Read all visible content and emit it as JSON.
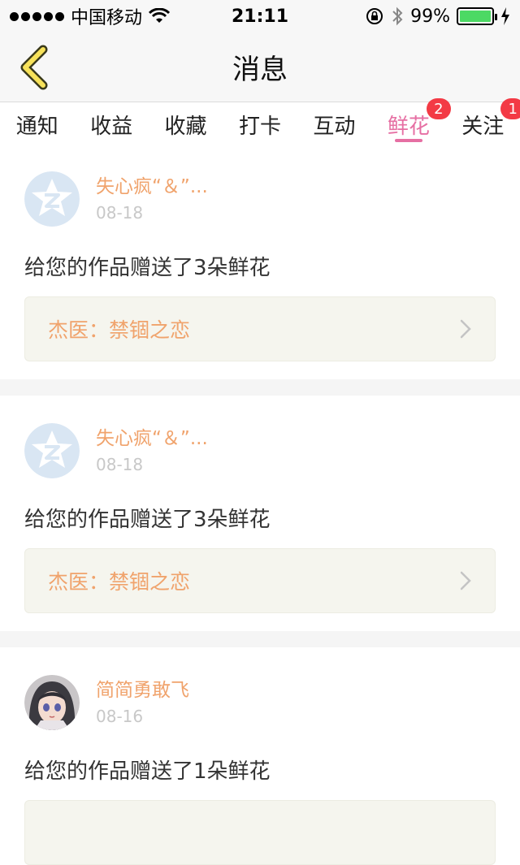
{
  "status_bar": {
    "carrier": "中国移动",
    "time": "21:11",
    "battery": "99%",
    "battery_level": 0.99
  },
  "nav": {
    "title": "消息"
  },
  "tabs": [
    {
      "label": "通知"
    },
    {
      "label": "收益"
    },
    {
      "label": "收藏"
    },
    {
      "label": "打卡"
    },
    {
      "label": "互动"
    },
    {
      "label": "鲜花",
      "badge": "2",
      "active": true
    },
    {
      "label": "关注",
      "badge": "1"
    }
  ],
  "messages": [
    {
      "username": "失心疯“＆”...",
      "date": "08-18",
      "message": "给您的作品赠送了3朵鲜花",
      "work_title": "杰医：禁锢之恋",
      "avatar": "default-qzone-avatar"
    },
    {
      "username": "失心疯“＆”...",
      "date": "08-18",
      "message": "给您的作品赠送了3朵鲜花",
      "work_title": "杰医：禁锢之恋",
      "avatar": "default-qzone-avatar"
    },
    {
      "username": "简简勇敢飞",
      "date": "08-16",
      "message": "给您的作品赠送了1朵鲜花",
      "avatar": "anime-girl-avatar"
    }
  ],
  "colors": {
    "accent_pink": "#e66fa3",
    "username_orange": "#f0a36c",
    "badge_red": "#f33a45",
    "back_chevron_yellow": "#f7e25a"
  }
}
